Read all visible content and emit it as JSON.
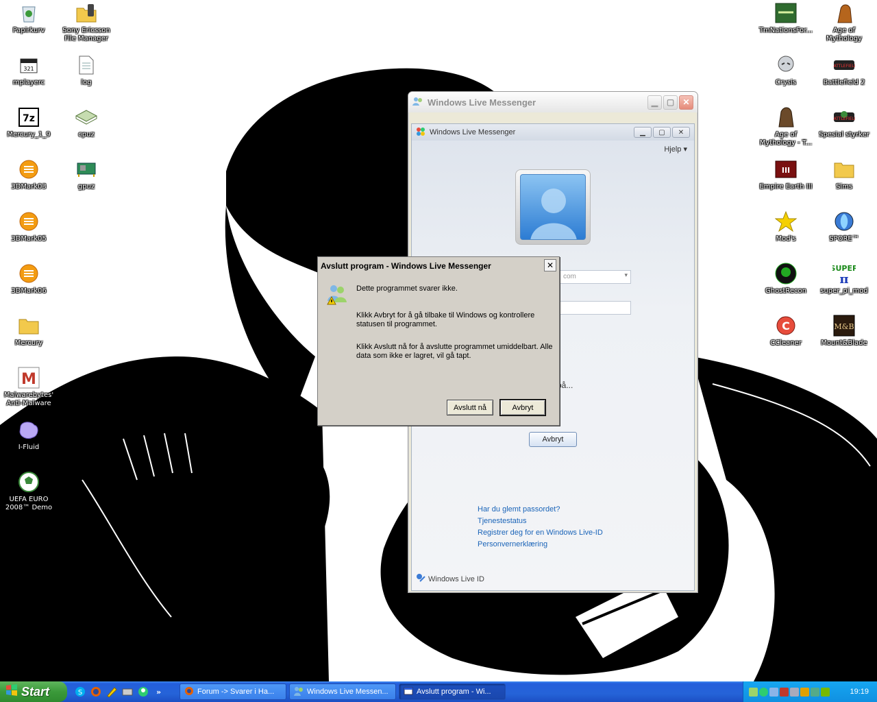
{
  "desktop": {
    "icons_left": [
      {
        "label": "Papirkurv",
        "icon": "recycle-bin-icon"
      },
      {
        "label": "Sony Ericsson File Manager",
        "icon": "folder-phone-icon"
      },
      {
        "label": "mplayerc",
        "icon": "media-player-icon"
      },
      {
        "label": "log",
        "icon": "text-file-icon"
      },
      {
        "label": "Mercury_1_9",
        "icon": "7zip-icon"
      },
      {
        "label": "cpuz",
        "icon": "cpu-chip-icon"
      },
      {
        "label": "3DMark03",
        "icon": "3dmark-icon"
      },
      {
        "label": "gpuz",
        "icon": "graphics-card-icon"
      },
      {
        "label": "3DMark05",
        "icon": "3dmark-icon"
      },
      {
        "label": "3DMark06",
        "icon": "3dmark-icon"
      },
      {
        "label": "Mercury",
        "icon": "folder-icon"
      },
      {
        "label": "Malwarebytes' Anti-Malware",
        "icon": "malwarebytes-icon"
      },
      {
        "label": "I-Fluid",
        "icon": "ifluid-icon"
      },
      {
        "label": "UEFA EURO 2008™ Demo",
        "icon": "soccer-ball-icon"
      }
    ],
    "icons_right": [
      {
        "label": "TmNationsFor...",
        "icon": "trackmania-icon"
      },
      {
        "label": "Age of Mythology",
        "icon": "age-of-mythology-icon"
      },
      {
        "label": "Crysis",
        "icon": "crysis-icon"
      },
      {
        "label": "Battlefield 2",
        "icon": "battlefield-icon"
      },
      {
        "label": "Age of Mythology - T...",
        "icon": "age-of-mythology-titans-icon"
      },
      {
        "label": "Spesial styrker",
        "icon": "battlefield-icon"
      },
      {
        "label": "Empire Earth III",
        "icon": "empire-earth-icon"
      },
      {
        "label": "Sims",
        "icon": "folder-icon"
      },
      {
        "label": "Mod's",
        "icon": "star-icon"
      },
      {
        "label": "SPORE™",
        "icon": "spore-icon"
      },
      {
        "label": "GhostRecon",
        "icon": "ghost-recon-icon"
      },
      {
        "label": "super_pi_mod",
        "icon": "super-pi-icon"
      },
      {
        "label": "CCleaner",
        "icon": "ccleaner-icon"
      },
      {
        "label": "Mount&Blade",
        "icon": "mount-blade-icon"
      }
    ]
  },
  "outer_window": {
    "title": "Windows Live Messenger"
  },
  "messenger": {
    "title": "Windows Live Messenger",
    "help": "Hjelp",
    "email_partial": "com",
    "partial_text_1": "på...",
    "cancel": "Avbryt",
    "links": [
      "Har du glemt passordet?",
      "Tjenestestatus",
      "Registrer deg for en Windows Live-ID",
      "Personvernerklæring"
    ],
    "footer": "Windows Live ID"
  },
  "dialog": {
    "title": "Avslutt program - Windows Live Messenger",
    "msg1": "Dette programmet svarer ikke.",
    "msg2": "Klikk Avbryt for å gå tilbake til Windows og kontrollere statusen til programmet.",
    "msg3": "Klikk Avslutt nå for å avslutte programmet umiddelbart. Alle data som ikke er lagret, vil gå tapt.",
    "end_now": "Avslutt nå",
    "cancel": "Avbryt"
  },
  "taskbar": {
    "start": "Start",
    "chevron": "»",
    "buttons": [
      "Forum -> Svarer i Ha...",
      "Windows Live Messen...",
      "Avslutt program - Wi..."
    ],
    "clock": "19:19"
  },
  "colors": {
    "taskbar_blue": "#245edb",
    "start_green": "#3b9a3a",
    "link_blue": "#1a64b8",
    "dialog_gray": "#d4d0c8"
  }
}
